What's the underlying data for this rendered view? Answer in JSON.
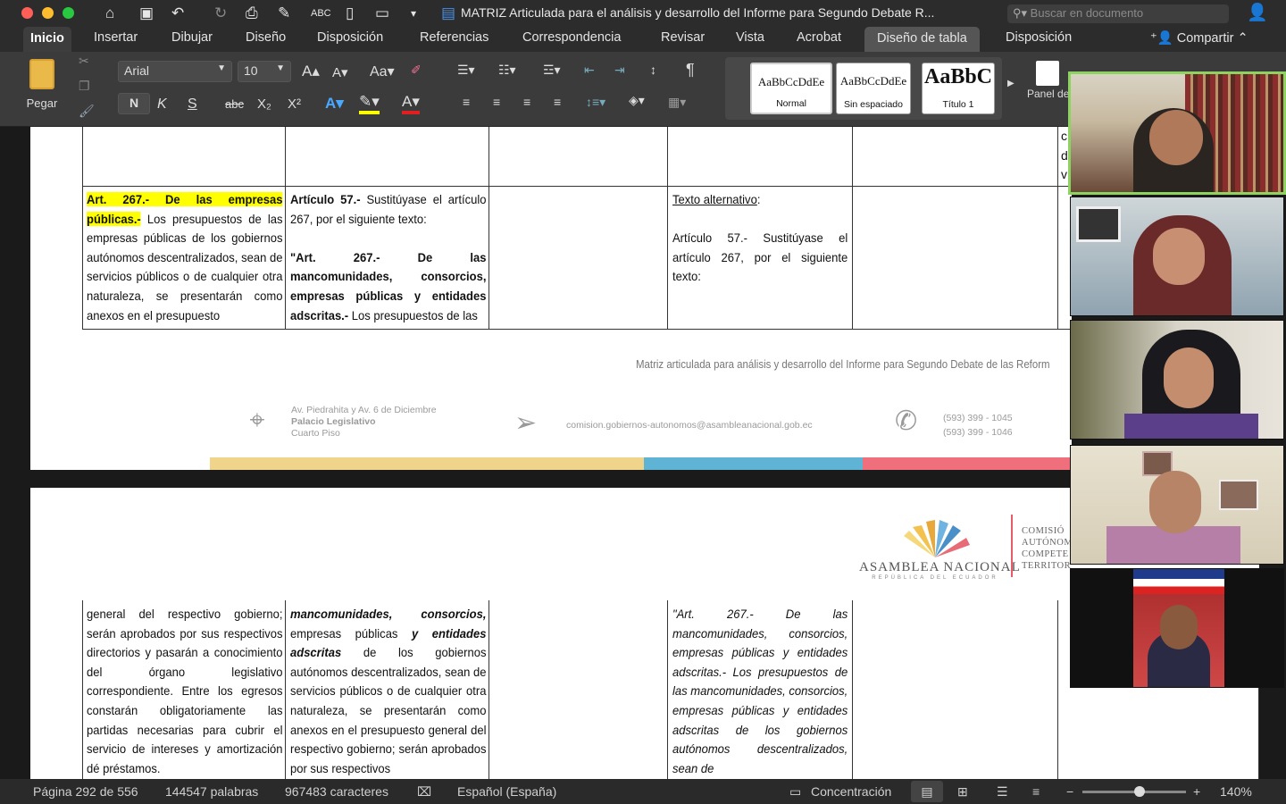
{
  "window": {
    "title": "MATRIZ Articulada para el análisis y desarrollo del Informe para Segundo Debate R...",
    "search_placeholder": "Buscar en documento"
  },
  "tabs": [
    "Inicio",
    "Insertar",
    "Dibujar",
    "Diseño",
    "Disposición",
    "Referencias",
    "Correspondencia",
    "Revisar",
    "Vista",
    "Acrobat",
    "Diseño de tabla",
    "Disposición"
  ],
  "share_label": "Compartir",
  "ribbon": {
    "paste_label": "Pegar",
    "font_name": "Arial",
    "font_size": "10",
    "bold": "N",
    "italic": "K",
    "underline": "S",
    "strike": "abc",
    "styles": [
      {
        "sample": "AaBbCcDdEe",
        "name": "Normal"
      },
      {
        "sample": "AaBbCcDdEe",
        "name": "Sin espaciado"
      },
      {
        "sample": "AaBbC",
        "name": "Título 1"
      }
    ],
    "styles_pane_label": "Panel de estilos"
  },
  "document": {
    "row1": {
      "col1_title": "Art. 267.- De las empresas públicas.-",
      "col1_text": "Los presupuestos de las empresas públicas de los gobiernos autónomos descentralizados, sean de servicios públicos o de cualquier otra naturaleza, se presentarán como anexos en el presupuesto",
      "col2_lead": "Artículo 57.-",
      "col2_text1": "Sustitúyase el artículo 267, por el siguiente texto:",
      "col2_quote": "\"Art. 267.- De las mancomunidades, consorcios, empresas públicas y entidades adscritas.-",
      "col2_text2": "Los presupuestos de las",
      "col4_heading": "Texto alternativo",
      "col4_text": "Artículo 57.- Sustitúyase el artículo 267, por el siguiente texto:"
    },
    "footer": {
      "running_title": "Matriz articulada para análisis y desarrollo del Informe para Segundo Debate de las Reform",
      "address1": "Av. Piedrahita y Av. 6 de Diciembre",
      "address2": "Palacio Legislativo",
      "address3": "Cuarto Piso",
      "email": "comision.gobiernos-autonomos@asambleanacional.gob.ec",
      "phone1": "(593) 399 - 1045",
      "phone2": "(593) 399 - 1046"
    },
    "header2": {
      "logo_name": "ASAMBLEA NACIONAL",
      "logo_sub": "REPÚBLICA DEL ECUADOR",
      "commission": [
        "COMISIÓ",
        "AUTÓNOM",
        "COMPETE",
        "TERRITOR"
      ]
    },
    "row2": {
      "col1_text": "general del respectivo gobierno; serán aprobados por sus respectivos directorios y pasarán a conocimiento del órgano legislativo correspondiente. Entre los egresos constarán obligatoriamente las partidas necesarias para cubrir el servicio de intereses y amortización dé préstamos.",
      "col2_bold1": "mancomunidades, consorcios,",
      "col2_t1": "empresas públicas",
      "col2_b2": "y entidades adscritas",
      "col2_t2": "de los gobiernos autónomos descentralizados, sean de servicios públicos o de cualquier otra naturaleza, se presentarán como anexos en el presupuesto general del respectivo gobierno; serán aprobados por sus respectivos",
      "col4_text": "\"Art. 267.- De las mancomunidades, consorcios, empresas públicas y entidades adscritas.- Los presupuestos de las mancomunidades, consorcios, empresas públicas y entidades adscritas de los gobiernos autónomos descentralizados, sean de"
    }
  },
  "status": {
    "page": "Página 292 de 556",
    "words": "144547 palabras",
    "chars": "967483 caracteres",
    "language": "Español (España)",
    "focus": "Concentración",
    "zoom": "140%",
    "zoom_level": 0.62
  },
  "colors": {
    "accent_green": "#8dd35f",
    "highlight": "#ffff00",
    "footer_yellow": "#f0d48a",
    "footer_blue": "#5fb4d6",
    "footer_pink": "#ef6f7c"
  }
}
